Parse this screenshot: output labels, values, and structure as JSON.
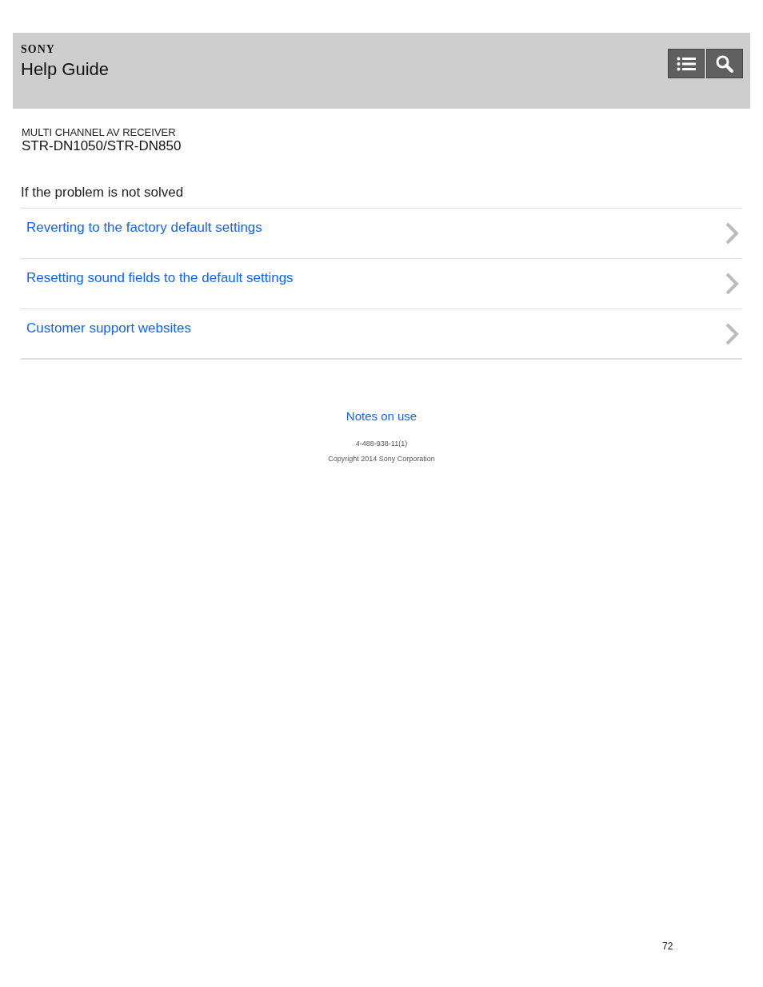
{
  "header": {
    "brand": "SONY",
    "title": "Help Guide"
  },
  "product": {
    "category": "MULTI CHANNEL AV RECEIVER",
    "model": "STR-DN1050/STR-DN850"
  },
  "section": {
    "heading": "If the problem is not solved",
    "links": [
      {
        "label": "Reverting to the factory default settings"
      },
      {
        "label": "Resetting sound fields to the default settings"
      },
      {
        "label": "Customer support websites"
      }
    ]
  },
  "footer": {
    "link": "Notes on use",
    "code": "4-488-938-11(1)",
    "copyright": "Copyright 2014 Sony Corporation"
  },
  "page_number": "72"
}
